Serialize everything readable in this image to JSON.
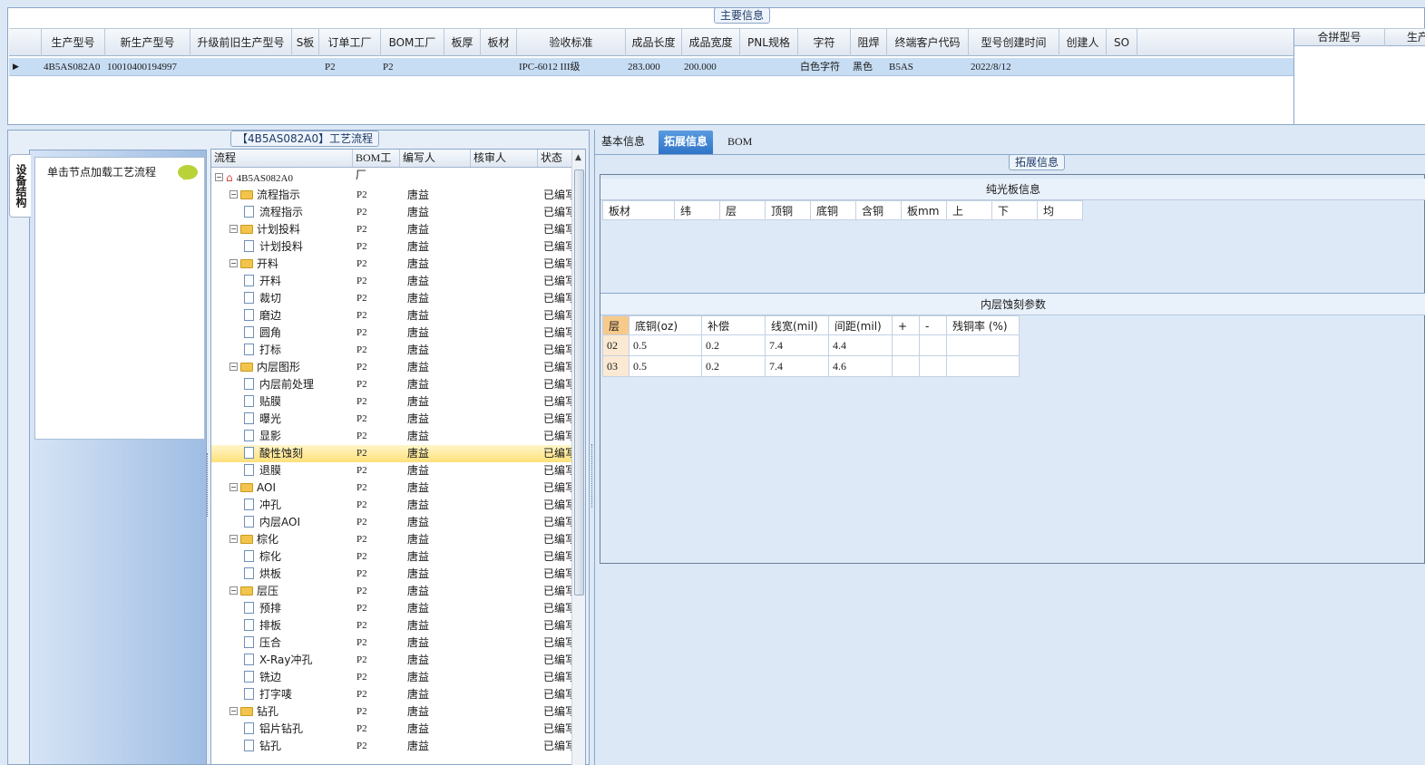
{
  "main_info": {
    "title": "主要信息",
    "columns": [
      "生产型号",
      "新生产型号",
      "升级前旧生产型号",
      "S板",
      "订单工厂",
      "BOM工厂",
      "板厚",
      "板材",
      "验收标准",
      "成品长度",
      "成品宽度",
      "PNL规格",
      "字符",
      "阻焊",
      "终端客户代码",
      "型号创建时间",
      "创建人",
      "SO"
    ],
    "row": {
      "prod_model": "4B5AS082A0",
      "new_prod_model": "10010400194997",
      "old_prod_model": "",
      "s_board": "",
      "order_factory": "P2",
      "bom_factory": "P2",
      "thickness": "",
      "material": "",
      "acceptance": "IPC-6012 III级",
      "length": "283.000",
      "width": "200.000",
      "pnl": "",
      "legend": "白色字符",
      "solder_mask": "黑色",
      "customer_code": "B5AS",
      "created_time": "2022/8/12",
      "creator": "",
      "so": ""
    },
    "right_columns": [
      "合拼型号",
      "生产"
    ]
  },
  "process": {
    "title": "【4B5AS082A0】工艺流程",
    "side_tab": "设备结构",
    "hint": "单击节点加载工艺流程",
    "columns": [
      "流程",
      "BOM工厂",
      "编写人",
      "核审人",
      "状态"
    ],
    "root": "4B5AS082A0",
    "rows": [
      {
        "name": "流程指示",
        "folder": true,
        "factory": "P2",
        "writer": "唐益",
        "status": "已编写"
      },
      {
        "name": "流程指示",
        "folder": false,
        "factory": "P2",
        "writer": "唐益",
        "status": "已编写"
      },
      {
        "name": "计划投料",
        "folder": true,
        "factory": "P2",
        "writer": "唐益",
        "status": "已编写"
      },
      {
        "name": "计划投料",
        "folder": false,
        "factory": "P2",
        "writer": "唐益",
        "status": "已编写"
      },
      {
        "name": "开料",
        "folder": true,
        "factory": "P2",
        "writer": "唐益",
        "status": "已编写"
      },
      {
        "name": "开料",
        "folder": false,
        "factory": "P2",
        "writer": "唐益",
        "status": "已编写"
      },
      {
        "name": "裁切",
        "folder": false,
        "factory": "P2",
        "writer": "唐益",
        "status": "已编写"
      },
      {
        "name": "磨边",
        "folder": false,
        "factory": "P2",
        "writer": "唐益",
        "status": "已编写"
      },
      {
        "name": "圆角",
        "folder": false,
        "factory": "P2",
        "writer": "唐益",
        "status": "已编写"
      },
      {
        "name": "打标",
        "folder": false,
        "factory": "P2",
        "writer": "唐益",
        "status": "已编写"
      },
      {
        "name": "内层图形",
        "folder": true,
        "factory": "P2",
        "writer": "唐益",
        "status": "已编写"
      },
      {
        "name": "内层前处理",
        "folder": false,
        "factory": "P2",
        "writer": "唐益",
        "status": "已编写"
      },
      {
        "name": "贴膜",
        "folder": false,
        "factory": "P2",
        "writer": "唐益",
        "status": "已编写"
      },
      {
        "name": "曝光",
        "folder": false,
        "factory": "P2",
        "writer": "唐益",
        "status": "已编写"
      },
      {
        "name": "显影",
        "folder": false,
        "factory": "P2",
        "writer": "唐益",
        "status": "已编写"
      },
      {
        "name": "酸性蚀刻",
        "folder": false,
        "factory": "P2",
        "writer": "唐益",
        "status": "已编写",
        "selected": true
      },
      {
        "name": "退膜",
        "folder": false,
        "factory": "P2",
        "writer": "唐益",
        "status": "已编写"
      },
      {
        "name": "AOI",
        "folder": true,
        "factory": "P2",
        "writer": "唐益",
        "status": "已编写"
      },
      {
        "name": "冲孔",
        "folder": false,
        "factory": "P2",
        "writer": "唐益",
        "status": "已编写"
      },
      {
        "name": "内层AOI",
        "folder": false,
        "factory": "P2",
        "writer": "唐益",
        "status": "已编写"
      },
      {
        "name": "棕化",
        "folder": true,
        "factory": "P2",
        "writer": "唐益",
        "status": "已编写"
      },
      {
        "name": "棕化",
        "folder": false,
        "factory": "P2",
        "writer": "唐益",
        "status": "已编写"
      },
      {
        "name": "烘板",
        "folder": false,
        "factory": "P2",
        "writer": "唐益",
        "status": "已编写"
      },
      {
        "name": "层压",
        "folder": true,
        "factory": "P2",
        "writer": "唐益",
        "status": "已编写"
      },
      {
        "name": "预排",
        "folder": false,
        "factory": "P2",
        "writer": "唐益",
        "status": "已编写"
      },
      {
        "name": "排板",
        "folder": false,
        "factory": "P2",
        "writer": "唐益",
        "status": "已编写"
      },
      {
        "name": "压合",
        "folder": false,
        "factory": "P2",
        "writer": "唐益",
        "status": "已编写"
      },
      {
        "name": "X-Ray冲孔",
        "folder": false,
        "factory": "P2",
        "writer": "唐益",
        "status": "已编写"
      },
      {
        "name": "铣边",
        "folder": false,
        "factory": "P2",
        "writer": "唐益",
        "status": "已编写"
      },
      {
        "name": "打字唛",
        "folder": false,
        "factory": "P2",
        "writer": "唐益",
        "status": "已编写"
      },
      {
        "name": "钻孔",
        "folder": true,
        "factory": "P2",
        "writer": "唐益",
        "status": "已编写"
      },
      {
        "name": "铝片钻孔",
        "folder": false,
        "factory": "P2",
        "writer": "唐益",
        "status": "已编写"
      },
      {
        "name": "钻孔",
        "folder": false,
        "factory": "P2",
        "writer": "唐益",
        "status": "已编写"
      }
    ]
  },
  "tabs": [
    "基本信息",
    "拓展信息",
    "BOM"
  ],
  "extended": {
    "title": "拓展信息",
    "plain_board": {
      "title": "纯光板信息",
      "columns": [
        "板材",
        "纬",
        "层",
        "顶铜",
        "底铜",
        "含铜",
        "板mm",
        "上",
        "下",
        "均"
      ]
    },
    "inner_etch": {
      "title": "内层蚀刻参数",
      "columns": [
        "层",
        "底铜(oz)",
        "补偿",
        "线宽(mil)",
        "间距(mil)",
        "+",
        "-",
        "残铜率 (%)"
      ],
      "rows": [
        [
          "02",
          "0.5",
          "0.2",
          "7.4",
          "4.4",
          "",
          "",
          ""
        ],
        [
          "03",
          "0.5",
          "0.2",
          "7.4",
          "4.6",
          "",
          "",
          ""
        ]
      ]
    }
  }
}
